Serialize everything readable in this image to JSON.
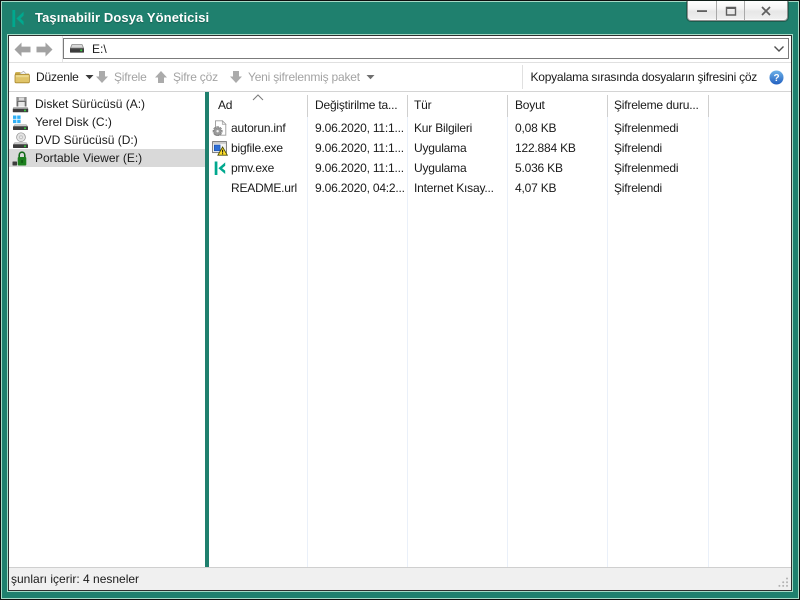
{
  "window": {
    "title": "Taşınabilir Dosya Yöneticisi",
    "logo_icon": "kaspersky-logo",
    "controls": {
      "minimize_icon": "minimize-icon",
      "maximize_icon": "maximize-icon",
      "close_icon": "close-icon"
    }
  },
  "navbar": {
    "back_icon": "back-arrow-icon",
    "forward_icon": "forward-arrow-icon",
    "address": {
      "drive_icon": "drive-icon",
      "value": "E:\\",
      "dropdown_icon": "chevron-down-icon"
    }
  },
  "toolbar": {
    "duzenle": {
      "label": "Düzenle",
      "icon": "folder-icon",
      "caret_icon": "caret-down-icon",
      "enabled": true
    },
    "sifrele": {
      "label": "Şifrele",
      "icon": "encrypt-down-arrow-icon",
      "enabled": false
    },
    "sifre_coz": {
      "label": "Şifre çöz",
      "icon": "decrypt-up-arrow-icon",
      "enabled": false
    },
    "yeni_paket": {
      "label": "Yeni şifrelenmiş paket",
      "icon": "package-down-arrow-icon",
      "caret_icon": "caret-down-icon",
      "enabled": false
    },
    "copy_option": {
      "label": "Kopyalama sırasında dosyaların şifresini çöz",
      "help_icon": "help-icon",
      "enabled": true
    }
  },
  "tree": {
    "items": [
      {
        "label": "Disket Sürücüsü (A:)",
        "icon": "floppy-drive-icon",
        "selected": false
      },
      {
        "label": "Yerel Disk (C:)",
        "icon": "local-disk-icon",
        "selected": false
      },
      {
        "label": "DVD Sürücüsü (D:)",
        "icon": "dvd-drive-icon",
        "selected": false
      },
      {
        "label": "Portable Viewer (E:)",
        "icon": "lock-drive-icon",
        "selected": true
      }
    ]
  },
  "table": {
    "sort_icon": "sort-up-chevron-icon",
    "headers": {
      "name": "Ad",
      "date": "Değiştirilme ta...",
      "type": "Tür",
      "size": "Boyut",
      "status": "Şifreleme duru..."
    },
    "rows": [
      {
        "name": "autorun.inf",
        "icon": "inf-file-icon",
        "date": "9.06.2020, 11:1...",
        "type": "Kur Bilgileri",
        "size": "0,08 KB",
        "status": "Şifrelenmedi"
      },
      {
        "name": "bigfile.exe",
        "icon": "exe-file-icon",
        "date": "9.06.2020, 11:1...",
        "type": "Uygulama",
        "size": "122.884 KB",
        "status": "Şifrelendi"
      },
      {
        "name": "pmv.exe",
        "icon": "kaspersky-file-icon",
        "date": "9.06.2020, 11:1...",
        "type": "Uygulama",
        "size": "5.036 KB",
        "status": "Şifrelenmedi"
      },
      {
        "name": "README.url",
        "icon": "none",
        "date": "9.06.2020, 04:2...",
        "type": "Internet Kısay...",
        "size": "4,07 KB",
        "status": "Şifrelendi"
      }
    ]
  },
  "statusbar": {
    "text": "şunları içerir: 4 nesneler",
    "grip_icon": "resize-grip-icon"
  },
  "colors": {
    "frame_green": "#1f806e",
    "frame_mint": "#a6dbc7",
    "selection_grey": "#d9d9d9",
    "disabled_text": "#a3a3a3",
    "kaspersky_teal": "#00a88e",
    "lock_green": "#1c7f1e",
    "help_blue": "#2f74d0"
  }
}
